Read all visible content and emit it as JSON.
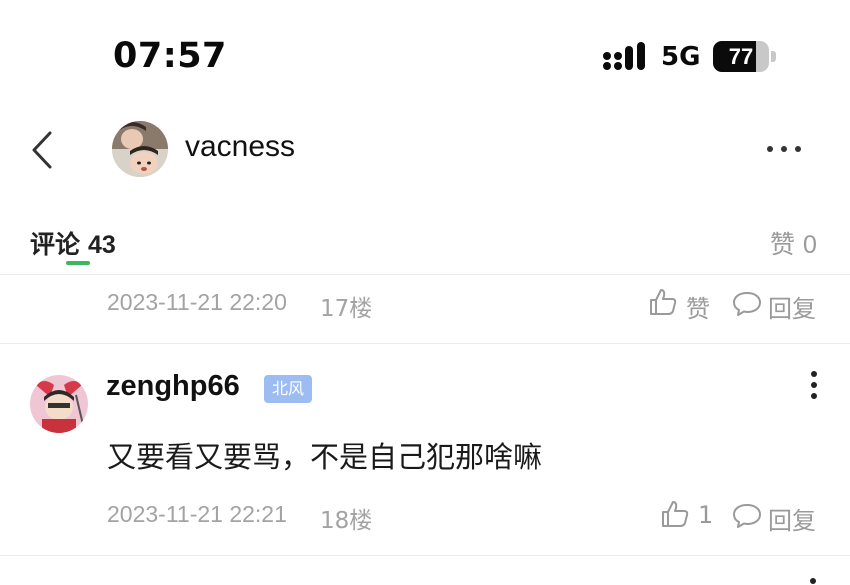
{
  "status_bar": {
    "time": "07:57",
    "network": "5G",
    "battery": "77",
    "battery_level": 0.77
  },
  "header": {
    "username": "vacness",
    "avatar": "user-avatar",
    "back_icon": "chevron-left-icon",
    "more_icon": "more-horizontal-icon"
  },
  "tabs": {
    "comments_label": "评论",
    "comments_count": "43",
    "likes_label": "赞",
    "likes_count": "0",
    "active_color": "#3bb75e"
  },
  "comments": [
    {
      "date": "2023-11-21 22:20",
      "floor": "17楼",
      "like_label": "赞",
      "reply_label": "回复"
    },
    {
      "username": "zenghp66",
      "badge": "北风",
      "badge_color": "#9cbcf2",
      "text": "又要看又要骂，不是自己犯那啥嘛",
      "date": "2023-11-21 22:21",
      "floor": "18楼",
      "like_count": "1",
      "reply_label": "回复"
    }
  ]
}
